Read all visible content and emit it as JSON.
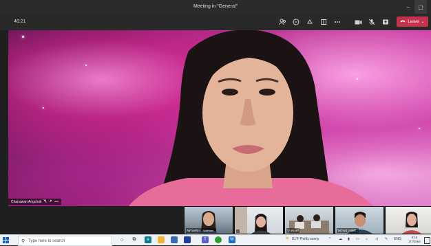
{
  "window": {
    "title": "Meeting in \"General\"",
    "minimize_glyph": "–",
    "maximize_glyph": "▢"
  },
  "toolbar": {
    "timer": "46:21",
    "icons": [
      "participants-icon",
      "chat-icon",
      "reactions-icon",
      "rooms-icon",
      "more-icon",
      "camera-icon",
      "mic-icon",
      "share-icon"
    ],
    "leave_label": "Leave",
    "leave_color": "#c4314b"
  },
  "main_video": {
    "participant_name": "Chanawan Angchok",
    "tag_icons": [
      "mic-muted-icon",
      "pin-icon",
      "more-icon"
    ]
  },
  "thumbnails": [
    {
      "label": "พัชรินทร์ดา - Sukthaw..."
    },
    {
      "label": "..."
    },
    {
      "label": "วา ทรงศรี"
    },
    {
      "label": "ไพโรจน์ วงษ์ศรี..."
    },
    {
      "label": ""
    }
  ],
  "taskbar": {
    "search_placeholder": "Type here to search",
    "weather": "81°F  Partly sunny",
    "language": "ENG",
    "time": "9:15",
    "date": "2/7/2564"
  }
}
